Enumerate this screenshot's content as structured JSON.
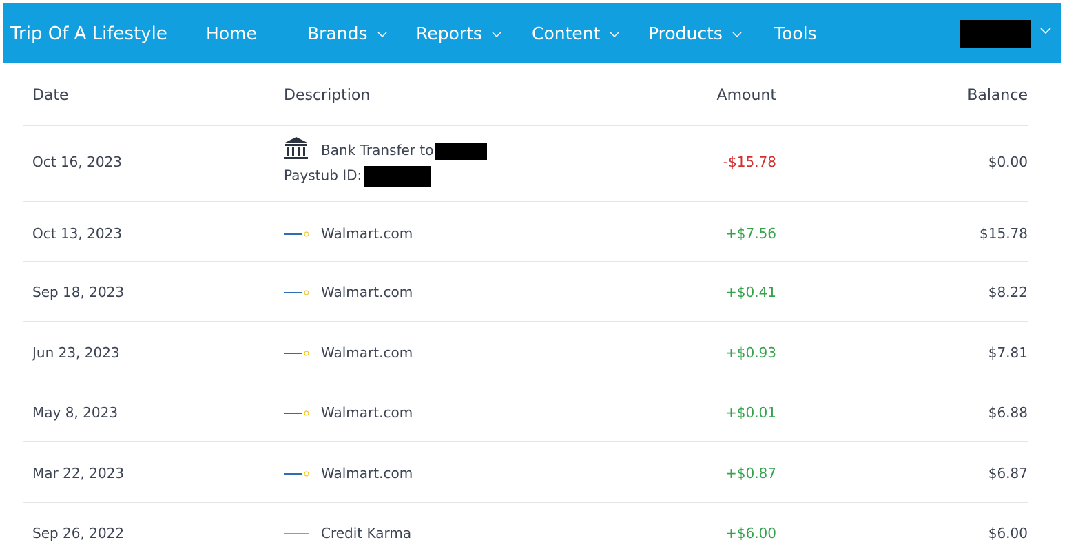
{
  "nav": {
    "brand": "Trip Of A Lifestyle",
    "home": "Home",
    "brands": "Brands",
    "reports": "Reports",
    "content": "Content",
    "products": "Products",
    "tools": "Tools"
  },
  "table": {
    "headers": {
      "date": "Date",
      "description": "Description",
      "amount": "Amount",
      "balance": "Balance"
    },
    "rows": [
      {
        "date": "Oct 16, 2023",
        "desc_line1": "Bank Transfer to",
        "desc_line2": "Paystub ID:",
        "amount": "-$15.78",
        "balance": "$0.00",
        "icon": "bank-icon"
      },
      {
        "date": "Oct 13, 2023",
        "desc": "Walmart.com",
        "amount": "+$7.56",
        "balance": "$15.78",
        "icon": "walmart-logo"
      },
      {
        "date": "Sep 18, 2023",
        "desc": "Walmart.com",
        "amount": "+$0.41",
        "balance": "$8.22",
        "icon": "walmart-logo"
      },
      {
        "date": "Jun 23, 2023",
        "desc": "Walmart.com",
        "amount": "+$0.93",
        "balance": "$7.81",
        "icon": "walmart-logo"
      },
      {
        "date": "May 8, 2023",
        "desc": "Walmart.com",
        "amount": "+$0.01",
        "balance": "$6.88",
        "icon": "walmart-logo"
      },
      {
        "date": "Mar 22, 2023",
        "desc": "Walmart.com",
        "amount": "+$0.87",
        "balance": "$6.87",
        "icon": "walmart-logo"
      },
      {
        "date": "Sep 26, 2022",
        "desc": "Credit Karma",
        "amount": "+$6.00",
        "balance": "$6.00",
        "icon": "credit-karma-logo"
      }
    ]
  },
  "colors": {
    "navbar": "#129fe0",
    "negative": "#d32f2f",
    "positive": "#34a34c",
    "divider": "#e3e5e8"
  }
}
